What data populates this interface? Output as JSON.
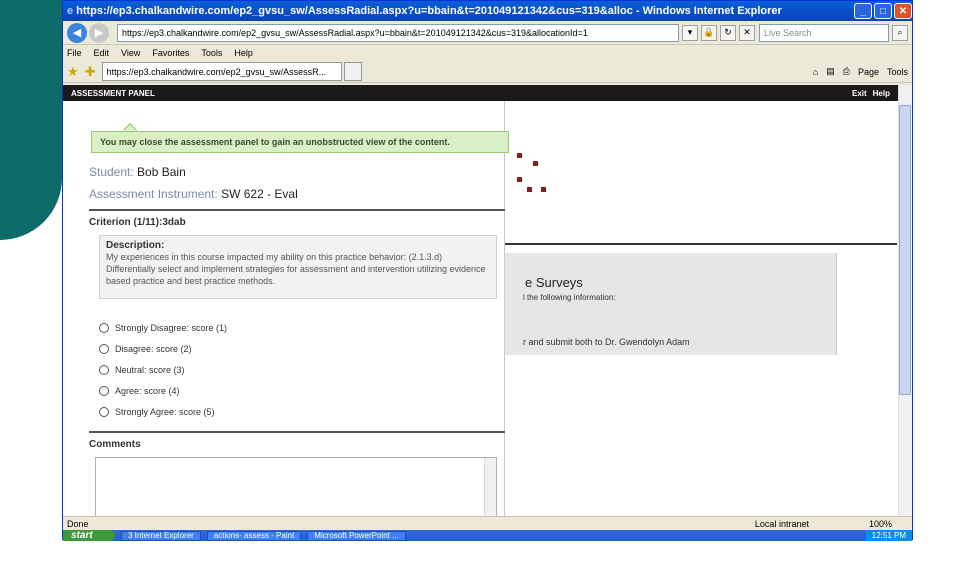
{
  "window": {
    "title": "https://ep3.chalkandwire.com/ep2_gvsu_sw/AssessRadial.aspx?u=bbain&t=201049121342&cus=319&alloc - Windows Internet Explorer",
    "url": "https://ep3.chalkandwire.com/ep2_gvsu_sw/AssessRadial.aspx?u=bbain&t=201049121342&cus=319&allocationId=1",
    "search_placeholder": "Live Search",
    "menus": [
      "File",
      "Edit",
      "View",
      "Favorites",
      "Tools",
      "Help"
    ],
    "tab_label": "https://ep3.chalkandwire.com/ep2_gvsu_sw/AssessR...",
    "cmd_page": "Page",
    "cmd_tools": "Tools"
  },
  "panel": {
    "header": "ASSESSMENT PANEL",
    "exit": "Exit",
    "help": "Help",
    "notice": "You may close the assessment panel to gain an unobstructed view of the content.",
    "student_label": "Student:",
    "student_name": "Bob Bain",
    "instrument_label": "Assessment Instrument:",
    "instrument_name": "SW 622 - Eval",
    "criterion": "Criterion (1/11):3dab",
    "description_label": "Description:",
    "description_text": "My experiences in this course impacted my ability on this practice behavior: (2.1.3.d) Differentially select and implement strategies for assessment and intervention utilizing evidence based practice and best practice methods.",
    "options": [
      "Strongly Disagree: score (1)",
      "Disagree: score (2)",
      "Neutral: score (3)",
      "Agree: score (4)",
      "Strongly Agree: score (5)"
    ],
    "comments_label": "Comments"
  },
  "background_page": {
    "surveys": "e Surveys",
    "follow": "l the following information:",
    "submit": "r and submit both to Dr. Gwendolyn Adam"
  },
  "status": {
    "left": "Done",
    "zone": "Local intranet",
    "zoom": "100%"
  },
  "taskbar": {
    "start": "start",
    "items": [
      "3 Internet Explorer",
      "actions- assess - Paint",
      "Microsoft PowerPoint ..."
    ],
    "clock": "12:51 PM"
  }
}
